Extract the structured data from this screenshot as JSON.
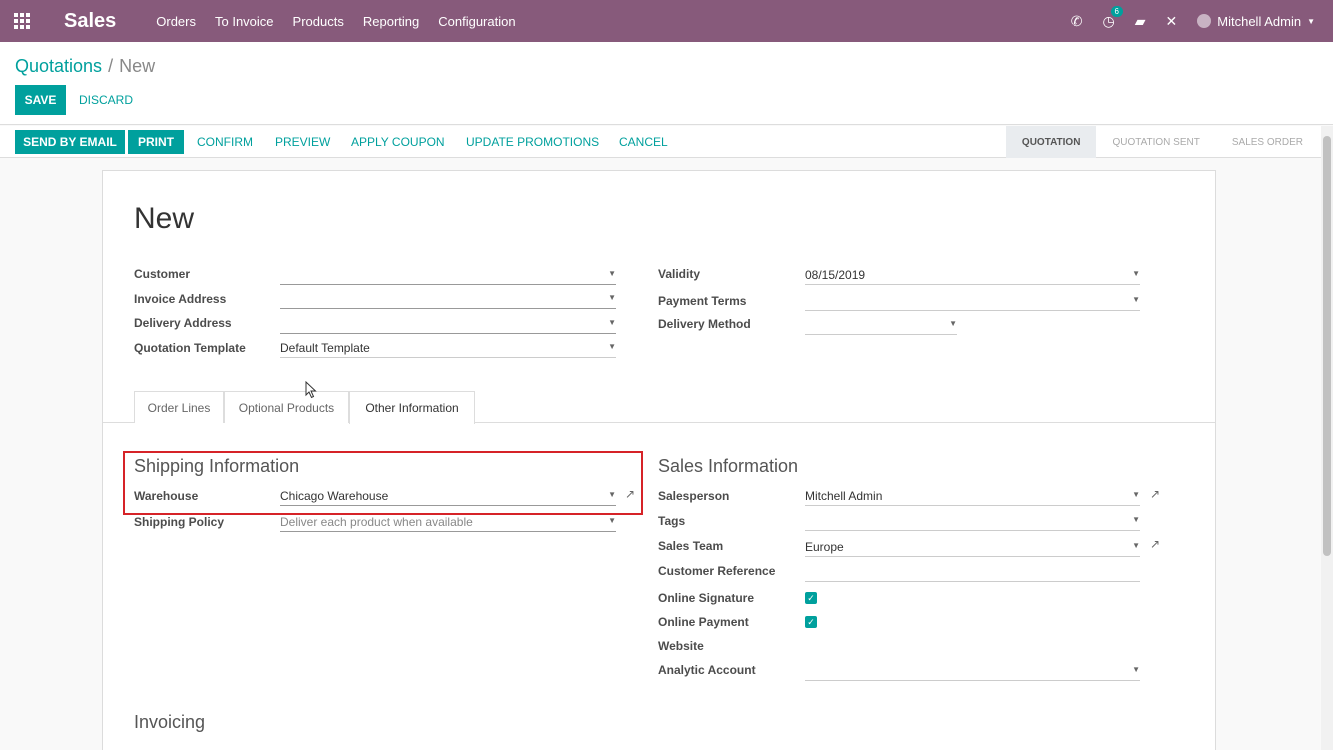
{
  "navbar": {
    "app_name": "Sales",
    "menu": [
      "Orders",
      "To Invoice",
      "Products",
      "Reporting",
      "Configuration"
    ],
    "activity_count": "6",
    "user_name": "Mitchell Admin"
  },
  "breadcrumb": {
    "parent": "Quotations",
    "separator": "/",
    "current": "New"
  },
  "actions": {
    "save": "SAVE",
    "discard": "DISCARD"
  },
  "statusbar": {
    "buttons": [
      "SEND BY EMAIL",
      "PRINT",
      "CONFIRM",
      "PREVIEW",
      "APPLY COUPON",
      "UPDATE PROMOTIONS",
      "CANCEL"
    ],
    "stages": [
      "QUOTATION",
      "QUOTATION SENT",
      "SALES ORDER"
    ]
  },
  "form": {
    "title": "New",
    "left_fields": [
      {
        "label": "Customer",
        "value": ""
      },
      {
        "label": "Invoice Address",
        "value": ""
      },
      {
        "label": "Delivery Address",
        "value": ""
      },
      {
        "label": "Quotation Template",
        "value": "Default Template"
      }
    ],
    "right_fields": [
      {
        "label": "Validity",
        "value": "08/15/2019"
      },
      {
        "label": "Payment Terms",
        "value": ""
      },
      {
        "label": "Delivery Method",
        "value": ""
      }
    ],
    "tabs": [
      "Order Lines",
      "Optional Products",
      "Other Information"
    ],
    "shipping": {
      "title": "Shipping Information",
      "warehouse_label": "Warehouse",
      "warehouse_value": "Chicago Warehouse",
      "policy_label": "Shipping Policy",
      "policy_value": "Deliver each product when available"
    },
    "sales_info": {
      "title": "Sales Information",
      "salesperson_label": "Salesperson",
      "salesperson_value": "Mitchell Admin",
      "tags_label": "Tags",
      "tags_value": "",
      "team_label": "Sales Team",
      "team_value": "Europe",
      "customer_ref_label": "Customer Reference",
      "customer_ref_value": "",
      "online_signature_label": "Online Signature",
      "online_signature_checked": true,
      "online_payment_label": "Online Payment",
      "online_payment_checked": true,
      "website_label": "Website",
      "analytic_label": "Analytic Account",
      "analytic_value": ""
    },
    "invoicing": {
      "title": "Invoicing"
    }
  },
  "colors": {
    "brand": "#875a7b",
    "primary": "#00a09d",
    "highlight": "#d62328"
  }
}
